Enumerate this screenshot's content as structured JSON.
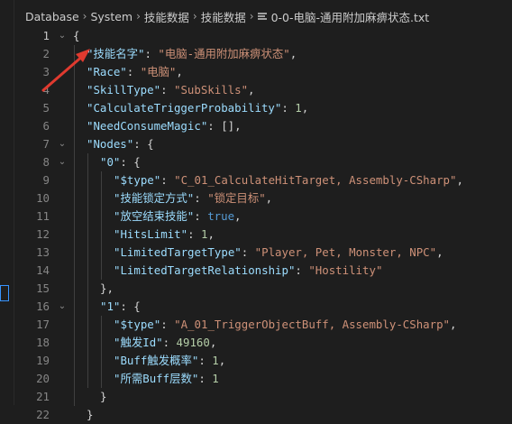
{
  "breadcrumb": {
    "items": [
      "Database",
      "System",
      "技能数据",
      "技能数据"
    ],
    "file_name": "0-0-电脑-通用附加麻痹状态.txt"
  },
  "editor": {
    "active_line": 1,
    "lines": [
      {
        "num": "1",
        "tokens": [
          {
            "t": "{",
            "c": "p"
          }
        ]
      },
      {
        "num": "2",
        "tokens": [
          {
            "t": "\"技能名字\"",
            "c": "k"
          },
          {
            "t": ": ",
            "c": "p"
          },
          {
            "t": "\"电脑-通用附加麻痹状态\"",
            "c": "s"
          },
          {
            "t": ",",
            "c": "p"
          }
        ]
      },
      {
        "num": "3",
        "tokens": [
          {
            "t": "\"Race\"",
            "c": "k"
          },
          {
            "t": ": ",
            "c": "p"
          },
          {
            "t": "\"电脑\"",
            "c": "s"
          },
          {
            "t": ",",
            "c": "p"
          }
        ]
      },
      {
        "num": "4",
        "tokens": [
          {
            "t": "\"SkillType\"",
            "c": "k"
          },
          {
            "t": ": ",
            "c": "p"
          },
          {
            "t": "\"SubSkills\"",
            "c": "s"
          },
          {
            "t": ",",
            "c": "p"
          }
        ]
      },
      {
        "num": "5",
        "tokens": [
          {
            "t": "\"CalculateTriggerProbability\"",
            "c": "k"
          },
          {
            "t": ": ",
            "c": "p"
          },
          {
            "t": "1",
            "c": "n"
          },
          {
            "t": ",",
            "c": "p"
          }
        ]
      },
      {
        "num": "6",
        "tokens": [
          {
            "t": "\"NeedConsumeMagic\"",
            "c": "k"
          },
          {
            "t": ": [],",
            "c": "p"
          }
        ]
      },
      {
        "num": "7",
        "tokens": [
          {
            "t": "\"Nodes\"",
            "c": "k"
          },
          {
            "t": ": {",
            "c": "p"
          }
        ]
      },
      {
        "num": "8",
        "tokens": [
          {
            "t": "\"0\"",
            "c": "k"
          },
          {
            "t": ": {",
            "c": "p"
          }
        ]
      },
      {
        "num": "9",
        "tokens": [
          {
            "t": "\"$type\"",
            "c": "k"
          },
          {
            "t": ": ",
            "c": "p"
          },
          {
            "t": "\"C_01_CalculateHitTarget, Assembly-CSharp\"",
            "c": "s"
          },
          {
            "t": ",",
            "c": "p"
          }
        ]
      },
      {
        "num": "10",
        "tokens": [
          {
            "t": "\"技能锁定方式\"",
            "c": "k"
          },
          {
            "t": ": ",
            "c": "p"
          },
          {
            "t": "\"锁定目标\"",
            "c": "s"
          },
          {
            "t": ",",
            "c": "p"
          }
        ]
      },
      {
        "num": "11",
        "tokens": [
          {
            "t": "\"放空结束技能\"",
            "c": "k"
          },
          {
            "t": ": ",
            "c": "p"
          },
          {
            "t": "true",
            "c": "b"
          },
          {
            "t": ",",
            "c": "p"
          }
        ]
      },
      {
        "num": "12",
        "tokens": [
          {
            "t": "\"HitsLimit\"",
            "c": "k"
          },
          {
            "t": ": ",
            "c": "p"
          },
          {
            "t": "1",
            "c": "n"
          },
          {
            "t": ",",
            "c": "p"
          }
        ]
      },
      {
        "num": "13",
        "tokens": [
          {
            "t": "\"LimitedTargetType\"",
            "c": "k"
          },
          {
            "t": ": ",
            "c": "p"
          },
          {
            "t": "\"Player, Pet, Monster, NPC\"",
            "c": "s"
          },
          {
            "t": ",",
            "c": "p"
          }
        ]
      },
      {
        "num": "14",
        "tokens": [
          {
            "t": "\"LimitedTargetRelationship\"",
            "c": "k"
          },
          {
            "t": ": ",
            "c": "p"
          },
          {
            "t": "\"Hostility\"",
            "c": "s"
          }
        ]
      },
      {
        "num": "15",
        "tokens": [
          {
            "t": "},",
            "c": "p"
          }
        ]
      },
      {
        "num": "16",
        "tokens": [
          {
            "t": "\"1\"",
            "c": "k"
          },
          {
            "t": ": {",
            "c": "p"
          }
        ]
      },
      {
        "num": "17",
        "tokens": [
          {
            "t": "\"$type\"",
            "c": "k"
          },
          {
            "t": ": ",
            "c": "p"
          },
          {
            "t": "\"A_01_TriggerObjectBuff, Assembly-CSharp\"",
            "c": "s"
          },
          {
            "t": ",",
            "c": "p"
          }
        ]
      },
      {
        "num": "18",
        "tokens": [
          {
            "t": "\"触发Id\"",
            "c": "k"
          },
          {
            "t": ": ",
            "c": "p"
          },
          {
            "t": "49160",
            "c": "n"
          },
          {
            "t": ",",
            "c": "p"
          }
        ]
      },
      {
        "num": "19",
        "tokens": [
          {
            "t": "\"Buff触发概率\"",
            "c": "k"
          },
          {
            "t": ": ",
            "c": "p"
          },
          {
            "t": "1",
            "c": "n"
          },
          {
            "t": ",",
            "c": "p"
          }
        ]
      },
      {
        "num": "20",
        "tokens": [
          {
            "t": "\"所需Buff层数\"",
            "c": "k"
          },
          {
            "t": ": ",
            "c": "p"
          },
          {
            "t": "1",
            "c": "n"
          }
        ]
      },
      {
        "num": "21",
        "tokens": [
          {
            "t": "}",
            "c": "p"
          }
        ]
      },
      {
        "num": "22",
        "tokens": [
          {
            "t": "}",
            "c": "p"
          }
        ]
      }
    ]
  },
  "colors": {
    "background": "#1e1e1e",
    "key": "#9cdcfe",
    "string": "#ce9178",
    "number": "#b5cea8",
    "boolean": "#569cd6",
    "punctuation": "#d4d4d4",
    "line_number": "#858585",
    "annotation_arrow": "#e03a2f"
  },
  "icons": {
    "breadcrumb_separator": "chevron-right-icon",
    "file": "text-file-icon",
    "fold": "chevron-down-icon"
  }
}
